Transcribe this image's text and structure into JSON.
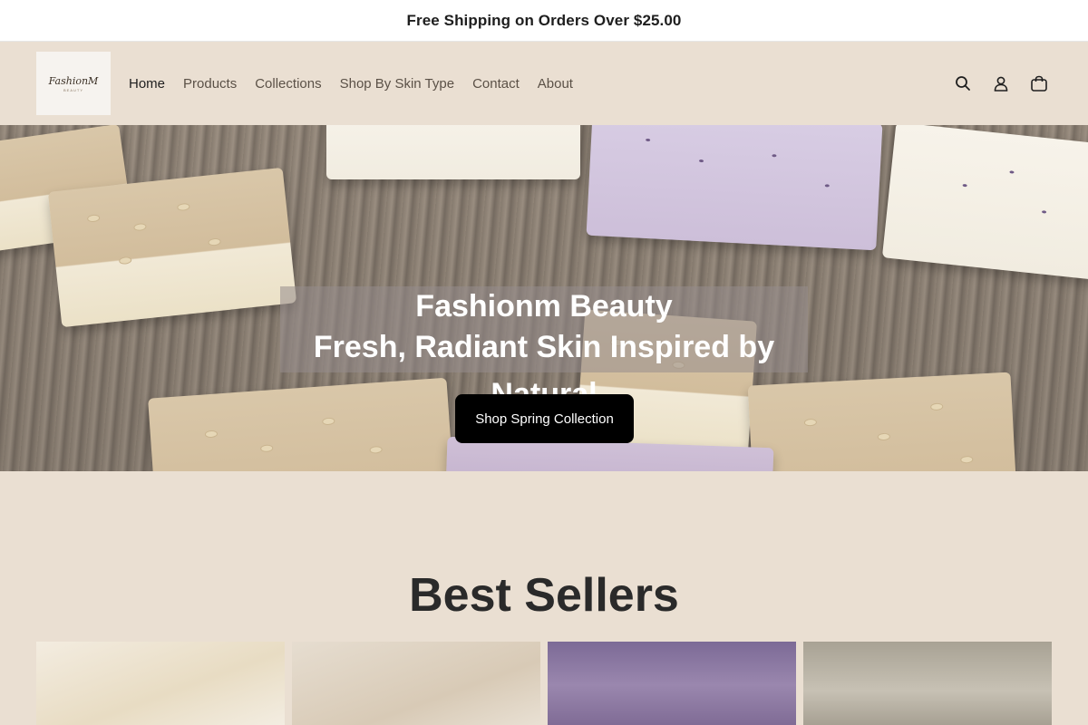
{
  "announcement": {
    "text": "Free Shipping on Orders Over $25.00"
  },
  "header": {
    "logo": {
      "script": "FashionM",
      "sub": "BEAUTY"
    },
    "nav": [
      {
        "label": "Home",
        "active": true
      },
      {
        "label": "Products"
      },
      {
        "label": "Collections"
      },
      {
        "label": "Shop By Skin Type"
      },
      {
        "label": "Contact"
      },
      {
        "label": "About"
      }
    ],
    "icons": [
      "search-icon",
      "account-icon",
      "cart-icon"
    ]
  },
  "hero": {
    "title": "Fashionm Beauty",
    "subtitle": "Fresh, Radiant Skin Inspired by Natural",
    "cta": "Shop Spring Collection"
  },
  "best_sellers": {
    "title": "Best Sellers",
    "products": [
      {
        "image": "honey-oat-soap-image"
      },
      {
        "image": "rice-milk-soap-image"
      },
      {
        "image": "lavender-soap-image"
      },
      {
        "image": "herbal-soap-image"
      }
    ]
  },
  "colors": {
    "background": "#eadfd2",
    "button": "#000000",
    "announcement_bg": "#ffffff"
  }
}
